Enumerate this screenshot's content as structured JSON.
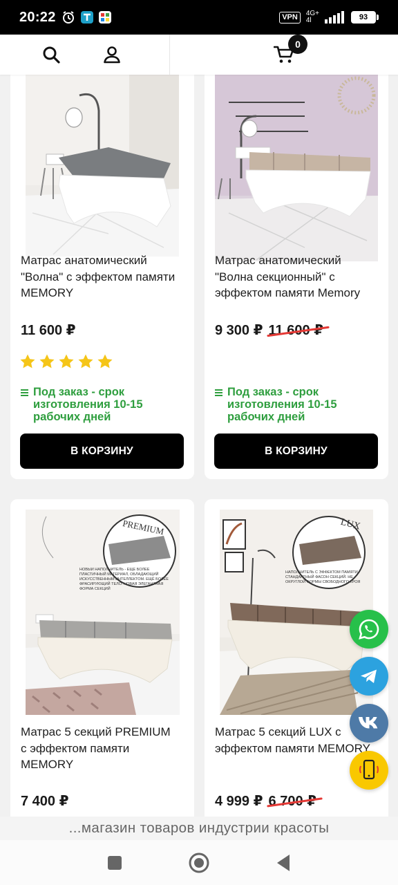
{
  "status_bar": {
    "time": "20:22",
    "vpn": "VPN",
    "network": "4G+",
    "network_sub": "4l",
    "battery": "93"
  },
  "header": {
    "cart_count": "0",
    "icons": [
      "search-icon",
      "user-icon",
      "cart-icon"
    ]
  },
  "products": [
    {
      "title_lines": [
        "Матрас анатомический",
        "\"Волна\" с эффектом памяти",
        "MEMORY"
      ],
      "price": "11 600 ₽",
      "old_price": "",
      "rating_stars": 5,
      "availability_lines": [
        "Под заказ - срок",
        "изготовления 10-15",
        "рабочих дней"
      ],
      "button": "В КОРЗИНУ"
    },
    {
      "title_lines": [
        "Матрас анатомический",
        "\"Волна секционный\" с",
        "эффектом памяти Memory"
      ],
      "price": "9 300 ₽",
      "old_price": "11 600 ₽",
      "rating_stars": 0,
      "availability_lines": [
        "Под заказ - срок",
        "изготовления 10-15",
        "рабочих дней"
      ],
      "button": "В КОРЗИНУ"
    },
    {
      "title_lines": [
        "Матрас 5 секций PREMIUM",
        "с эффектом памяти",
        "MEMORY"
      ],
      "price": "7 400 ₽",
      "old_price": "",
      "image_label": "PREMIUM",
      "image_caption": "НОВЫЙ НАПОЛНИТЕЛЬ - ЕЩЁ БОЛЕЕ ПЛАСТИЧНЫЙ МАТЕРИАЛ, ОБЛАДАЮЩИЙ ИСКУССТВЕННЫМ ИНТЕЛЛЕКТОМ. ЕЩЁ БОЛЕЕ ФРАСИРУЮЩИЙ ТЕЛО. НОВАЯ ЭЛЕГАНТНАЯ ФОРМА СЕКЦИЙ"
    },
    {
      "title_lines": [
        "Матрас 5 секций LUX с",
        "эффектом памяти MEMORY"
      ],
      "price": "4 999 ₽",
      "old_price": "6 700 ₽",
      "image_label": "LUX",
      "image_caption": "НАПОЛНИТЕЛЬ С ЭФФЕКТОМ ПАМЯТИ. СТАНДАРТНЫЙ ФАСОН СЕКЦИЙ. НЕ ОКРУГЛОЙ ФОРМЫ СВОБОДНОГО КРОЯ"
    }
  ],
  "floating_buttons": [
    "whatsapp-icon",
    "telegram-icon",
    "vk-icon",
    "phone-icon"
  ],
  "footer_banner": "...магазин товаров индустрии красоты",
  "colors": {
    "whatsapp": "#27c04a",
    "telegram": "#2ca2df",
    "vk": "#4e7aa7",
    "phone": "#f9c800",
    "stars": "#f5c518",
    "availability": "#2e9e3e",
    "strike": "#e53935"
  }
}
